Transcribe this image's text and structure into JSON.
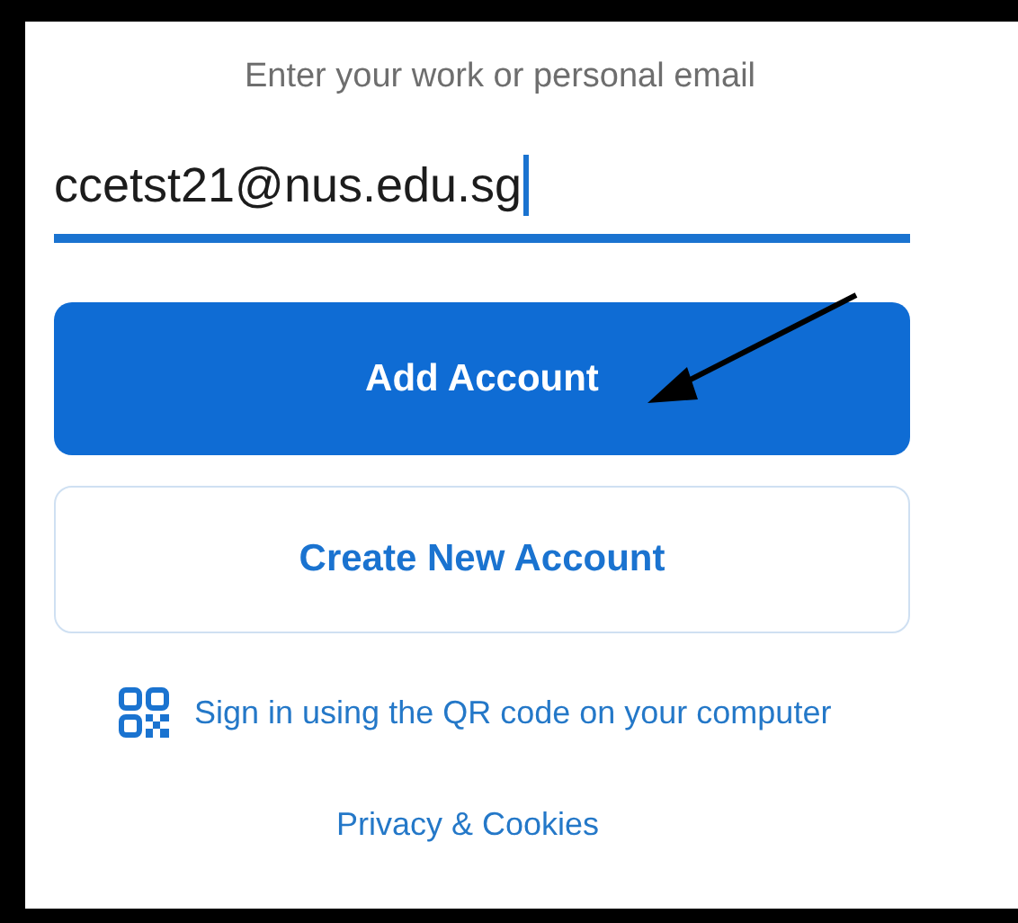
{
  "prompt": "Enter your work or personal email",
  "email_field": {
    "value": "ccetst21@nus.edu.sg",
    "focused": true
  },
  "buttons": [
    {
      "label": "Add Account",
      "kind": "primary"
    },
    {
      "label": "Create New Account",
      "kind": "secondary"
    }
  ],
  "qr_link": "Sign in using the QR code on your computer",
  "footer_link": "Privacy & Cookies"
}
